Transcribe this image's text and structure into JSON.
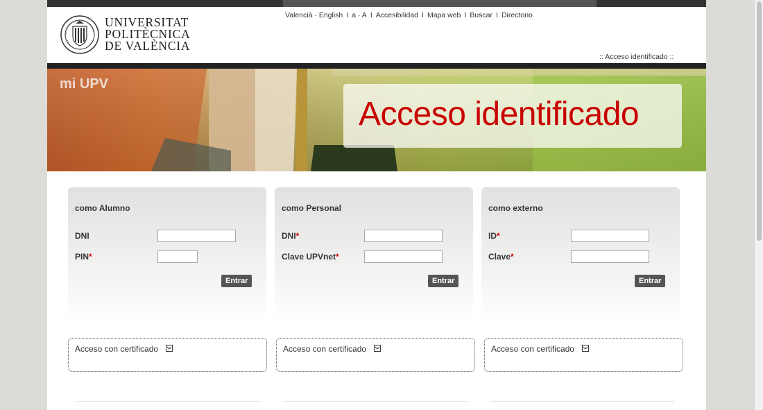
{
  "header": {
    "logo": {
      "line1": "UNIVERSITAT",
      "line2": "POLITÈCNICA",
      "line3": "DE VALÈNCIA"
    },
    "links": [
      "Valencià · English",
      "a · A",
      "Accesibilidad",
      "Mapa web",
      "Buscar",
      "Directorio"
    ],
    "separator": "I",
    "breadcrumb": "::  Acceso identificado  ::"
  },
  "banner": {
    "label": "mi UPV",
    "title": "Acceso identificado"
  },
  "panels": [
    {
      "title": "como Alumno",
      "fields": [
        {
          "label": "DNI",
          "required": false,
          "value": ""
        },
        {
          "label": "PIN",
          "required": true,
          "value": ""
        }
      ],
      "button": "Entrar",
      "cert": "Acceso con certificado"
    },
    {
      "title": "como Personal",
      "fields": [
        {
          "label": "DNI",
          "required": true,
          "value": ""
        },
        {
          "label": "Clave UPVnet",
          "required": true,
          "value": ""
        }
      ],
      "button": "Entrar",
      "cert": "Acceso con certificado"
    },
    {
      "title": "como externo",
      "fields": [
        {
          "label": "ID",
          "required": true,
          "value": ""
        },
        {
          "label": "Clave",
          "required": true,
          "value": ""
        }
      ],
      "button": "Entrar",
      "cert": "Acceso con certificado"
    }
  ],
  "required_mark": "*",
  "colors": {
    "accent_red": "#c80000",
    "button_bg": "#555555",
    "top_bar": "#333333"
  },
  "icons": {
    "cert": "external-link-icon"
  }
}
